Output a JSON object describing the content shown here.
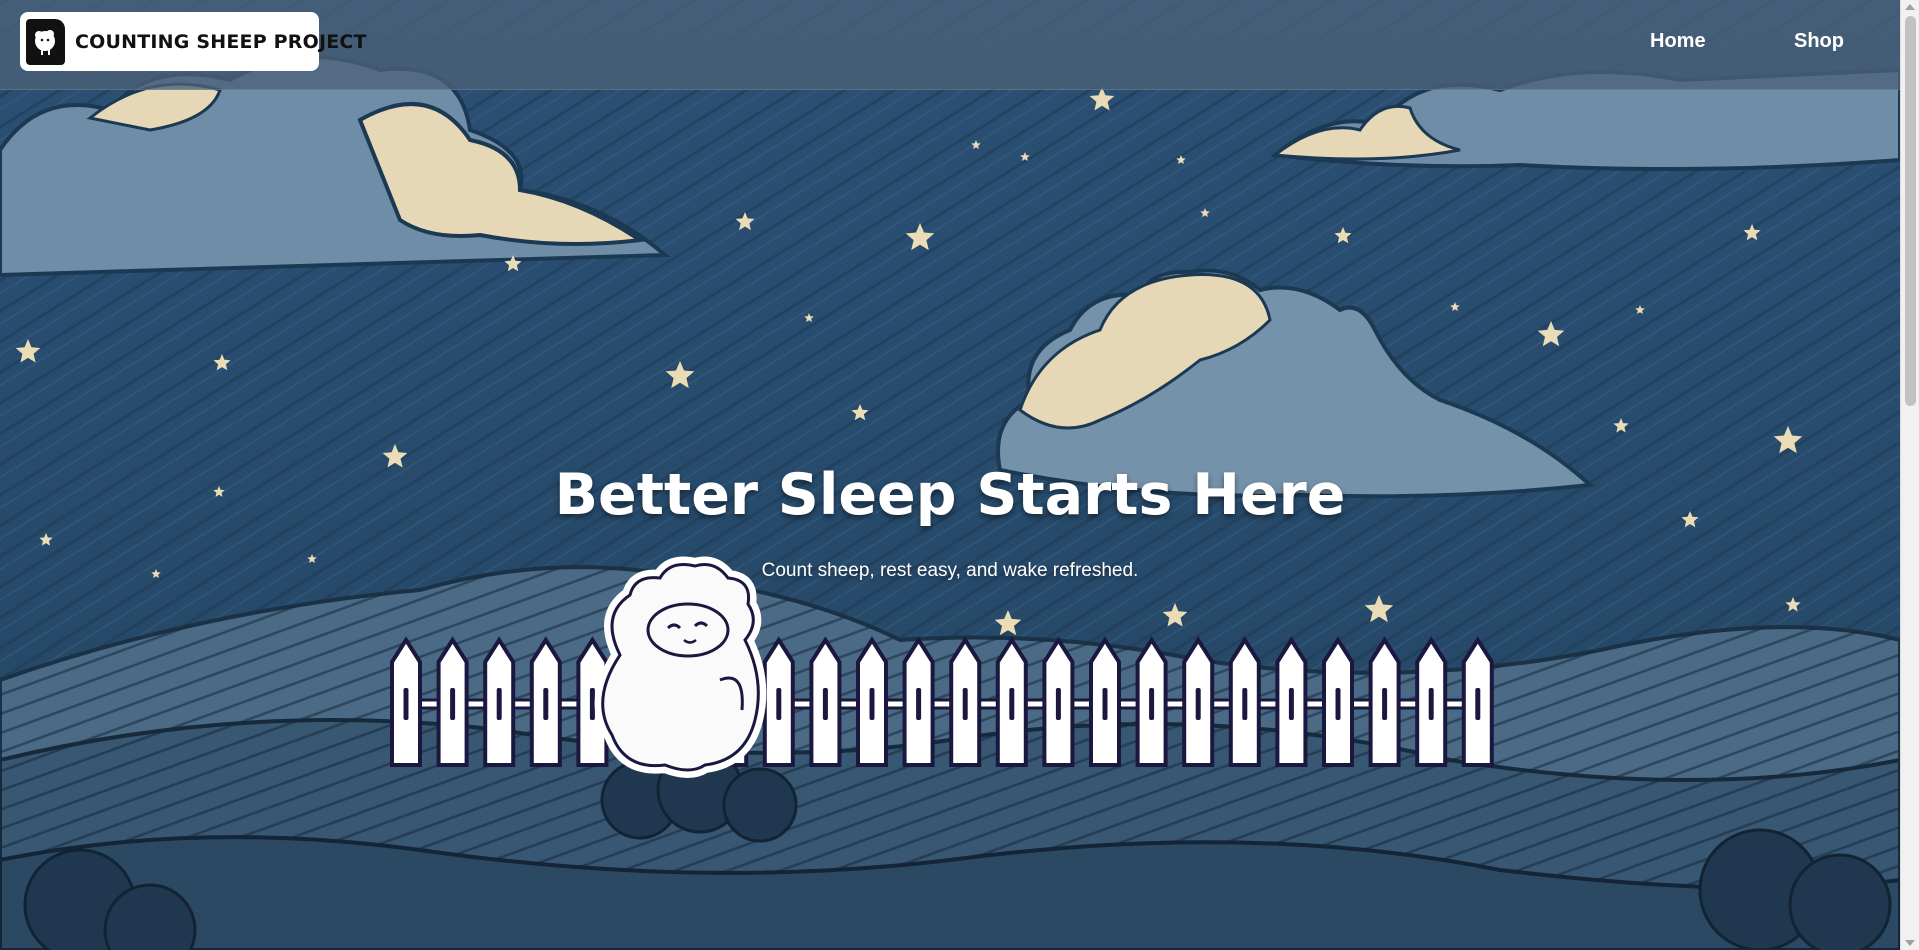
{
  "brand": {
    "name": "COUNTING SHEEP PROJECT",
    "logo_icon": "sheep-icon"
  },
  "nav": [
    {
      "label": "Home"
    },
    {
      "label": "Shop"
    }
  ],
  "hero": {
    "title": "Better Sleep Starts Here",
    "subtitle": "Count sheep, rest easy, and wake refreshed."
  },
  "colors": {
    "sky": "#24496b",
    "header_overlay": "#4b6278",
    "cloud": "#e9dcbd",
    "star": "#eadcb6",
    "fence": "#ffffff",
    "fence_outline": "#1b1840",
    "hill_dark": "#203a50",
    "hill_light": "#4f708b"
  }
}
